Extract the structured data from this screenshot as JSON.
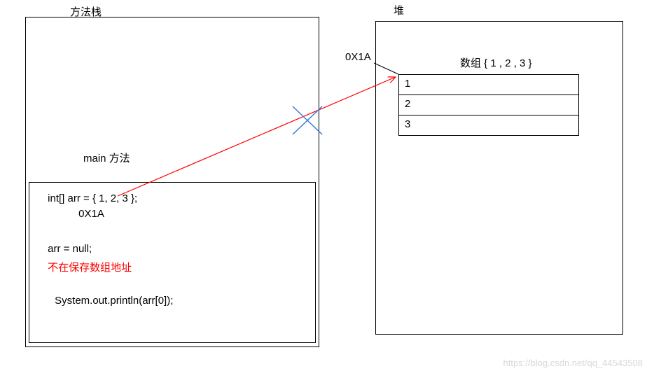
{
  "stack": {
    "title": "方法栈",
    "main_label": "main 方法",
    "code": {
      "decl": "int[] arr = { 1, 2, 3 };",
      "addr": "0X1A",
      "assign_null": "arr = null;",
      "note": "不在保存数组地址",
      "print": "System.out.println(arr[0]);"
    }
  },
  "heap": {
    "title": "堆",
    "addr_label": "0X1A",
    "array_label": "数组 { 1 , 2 , 3 }",
    "values": [
      "1",
      "2",
      "3"
    ]
  },
  "watermark": "https://blog.csdn.net/qq_44543508"
}
